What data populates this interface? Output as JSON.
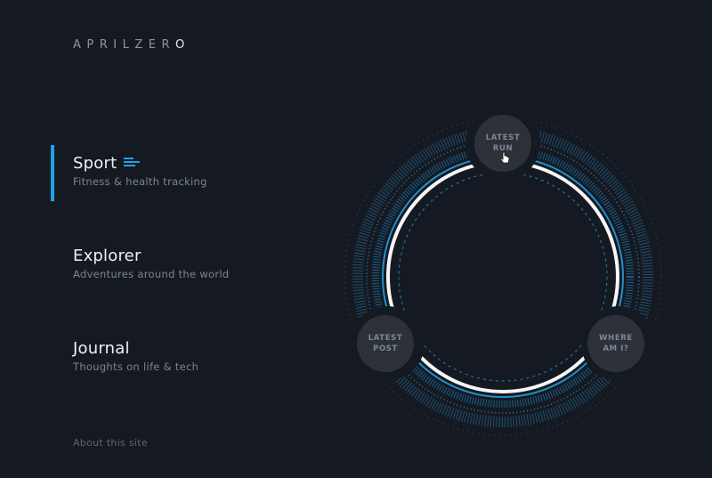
{
  "brand": {
    "logo_dim": "APRILZER",
    "logo_accent": "O"
  },
  "nav": {
    "items": [
      {
        "title": "Sport",
        "subtitle": "Fitness & health tracking",
        "active": true
      },
      {
        "title": "Explorer",
        "subtitle": "Adventures around the world",
        "active": false
      },
      {
        "title": "Journal",
        "subtitle": "Thoughts on life & tech",
        "active": false
      }
    ],
    "about_label": "About this site"
  },
  "ring": {
    "nodes": [
      {
        "label": "LATEST\nRUN"
      },
      {
        "label": "LATEST\nPOST"
      },
      {
        "label": "WHERE\nAM I?"
      }
    ]
  },
  "colors": {
    "background": "#151a22",
    "accent": "#1ea2e4",
    "node": "#2b3038",
    "text_primary": "#eef1f5",
    "text_secondary": "#7b8492"
  }
}
